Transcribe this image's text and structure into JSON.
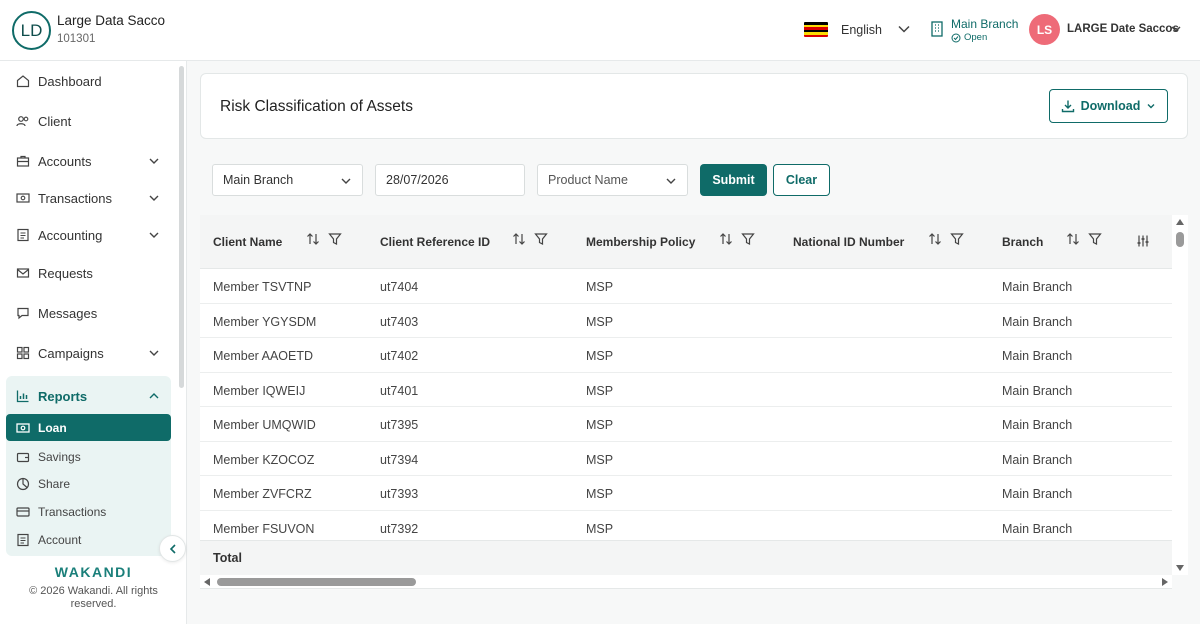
{
  "org": {
    "initials": "LD",
    "name": "Large Data Sacco",
    "code": "101301"
  },
  "language": {
    "label": "English",
    "flag_colors": [
      "#000000",
      "#fcdc04",
      "#d90000",
      "#000000",
      "#fcdc04",
      "#d90000"
    ]
  },
  "branch": {
    "name": "Main Branch",
    "status": "Open"
  },
  "user": {
    "initials": "LS",
    "name": "LARGE Date Saccos"
  },
  "sidebar": {
    "items": [
      {
        "label": "Dashboard",
        "icon": "home-icon"
      },
      {
        "label": "Client",
        "icon": "users-icon"
      },
      {
        "label": "Accounts",
        "icon": "briefcase-icon"
      },
      {
        "label": "Transactions",
        "icon": "cash-icon"
      },
      {
        "label": "Accounting",
        "icon": "ledger-icon"
      },
      {
        "label": "Requests",
        "icon": "mail-icon"
      },
      {
        "label": "Messages",
        "icon": "chat-icon"
      },
      {
        "label": "Campaigns",
        "icon": "grid-icon"
      }
    ],
    "reports": {
      "label": "Reports",
      "sub_items": [
        {
          "label": "Loan",
          "active": true
        },
        {
          "label": "Savings"
        },
        {
          "label": "Share"
        },
        {
          "label": "Transactions"
        },
        {
          "label": "Account"
        }
      ]
    },
    "brand": "WAKANDI",
    "copyright": "© 2026 Wakandi. All rights reserved."
  },
  "page": {
    "title": "Risk Classification of Assets",
    "download_label": "Download"
  },
  "filters": {
    "branch": "Main Branch",
    "date": "28/07/2026",
    "product_placeholder": "Product Name",
    "submit_label": "Submit",
    "clear_label": "Clear"
  },
  "table": {
    "columns": [
      "Client Name",
      "Client Reference ID",
      "Membership Policy",
      "National ID Number",
      "Branch"
    ],
    "rows": [
      [
        "Member TSVTNP",
        "ut7404",
        "MSP",
        "",
        "Main Branch"
      ],
      [
        "Member YGYSDM",
        "ut7403",
        "MSP",
        "",
        "Main Branch"
      ],
      [
        "Member AAOETD",
        "ut7402",
        "MSP",
        "",
        "Main Branch"
      ],
      [
        "Member IQWEIJ",
        "ut7401",
        "MSP",
        "",
        "Main Branch"
      ],
      [
        "Member UMQWID",
        "ut7395",
        "MSP",
        "",
        "Main Branch"
      ],
      [
        "Member KZOCOZ",
        "ut7394",
        "MSP",
        "",
        "Main Branch"
      ],
      [
        "Member ZVFCRZ",
        "ut7393",
        "MSP",
        "",
        "Main Branch"
      ],
      [
        "Member FSUVON",
        "ut7392",
        "MSP",
        "",
        "Main Branch"
      ]
    ],
    "footer_label": "Total"
  },
  "colors": {
    "primary": "#0f6b68",
    "avatar": "#ee6b78"
  }
}
